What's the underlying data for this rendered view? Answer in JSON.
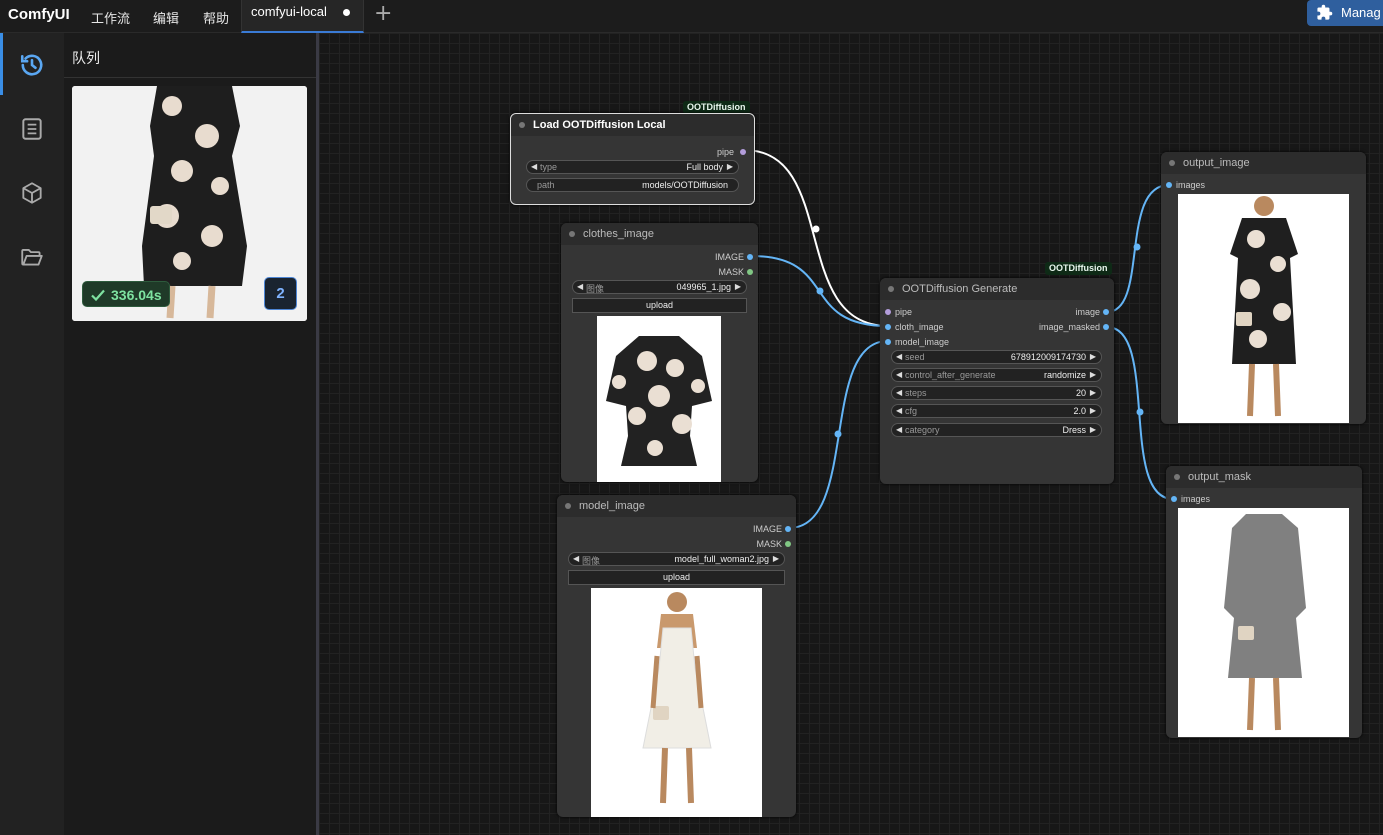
{
  "app": {
    "brand": "ComfyUI",
    "menus": [
      "工作流",
      "编辑",
      "帮助"
    ],
    "active_tab": "comfyui-local",
    "manager_label": "Manag"
  },
  "sidebar": {
    "items": [
      "history-icon",
      "book-icon",
      "cube-icon",
      "folder-icon"
    ],
    "active_index": 0
  },
  "queue": {
    "title": "队列",
    "time": "336.04s",
    "count": "2"
  },
  "nodes": {
    "load": {
      "badge": "OOTDiffusion",
      "title": "Load OOTDiffusion Local",
      "output": "pipe",
      "type_label": "type",
      "type_value": "Full body",
      "path_label": "path",
      "path_value": "models/OOTDiffusion"
    },
    "clothes": {
      "title": "clothes_image",
      "out_image": "IMAGE",
      "out_mask": "MASK",
      "image_label": "图像",
      "image_value": "049965_1.jpg",
      "upload": "upload"
    },
    "model": {
      "title": "model_image",
      "out_image": "IMAGE",
      "out_mask": "MASK",
      "image_label": "图像",
      "image_value": "model_full_woman2.jpg",
      "upload": "upload"
    },
    "generate": {
      "badge": "OOTDiffusion",
      "title": "OOTDiffusion Generate",
      "in_pipe": "pipe",
      "in_cloth": "cloth_image",
      "in_model": "model_image",
      "out_image": "image",
      "out_masked": "image_masked",
      "seed_label": "seed",
      "seed_value": "678912009174730",
      "cag_label": "control_after_generate",
      "cag_value": "randomize",
      "steps_label": "steps",
      "steps_value": "20",
      "cfg_label": "cfg",
      "cfg_value": "2.0",
      "category_label": "category",
      "category_value": "Dress"
    },
    "output_image": {
      "title": "output_image",
      "input": "images"
    },
    "output_mask": {
      "title": "output_mask",
      "input": "images"
    }
  },
  "colors": {
    "accent": "#3a8ee6",
    "image_link": "#64b5f6",
    "pipe_link": "#ffffff",
    "pipe_slot": "#b39ddb",
    "mask_slot": "#81c784",
    "badge_bg": "#0e2a16",
    "success": "#7ee2a0"
  }
}
